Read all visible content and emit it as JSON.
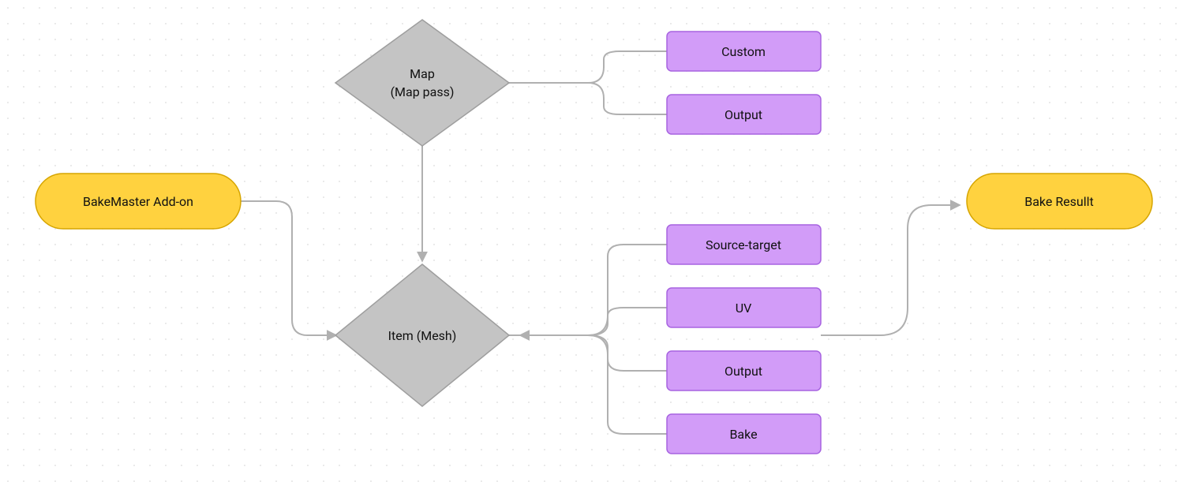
{
  "diagram": {
    "start": {
      "label": "BakeMaster Add-on"
    },
    "map": {
      "line1": "Map",
      "line2": "(Map pass)"
    },
    "item": {
      "label": "Item (Mesh)"
    },
    "result": {
      "label": "Bake Resullt"
    },
    "map_opts": {
      "custom": "Custom",
      "output": "Output"
    },
    "item_opts": {
      "source_target": "Source-target",
      "uv": "UV",
      "output": "Output",
      "bake": "Bake"
    }
  },
  "colors": {
    "pill": "#ffd23f",
    "pill_stroke": "#d6a500",
    "diamond": "#c4c4c4",
    "diamond_stroke": "#9e9e9e",
    "rect": "#d29cf8",
    "rect_stroke": "#a763e0",
    "edge": "#b0b0b0"
  }
}
